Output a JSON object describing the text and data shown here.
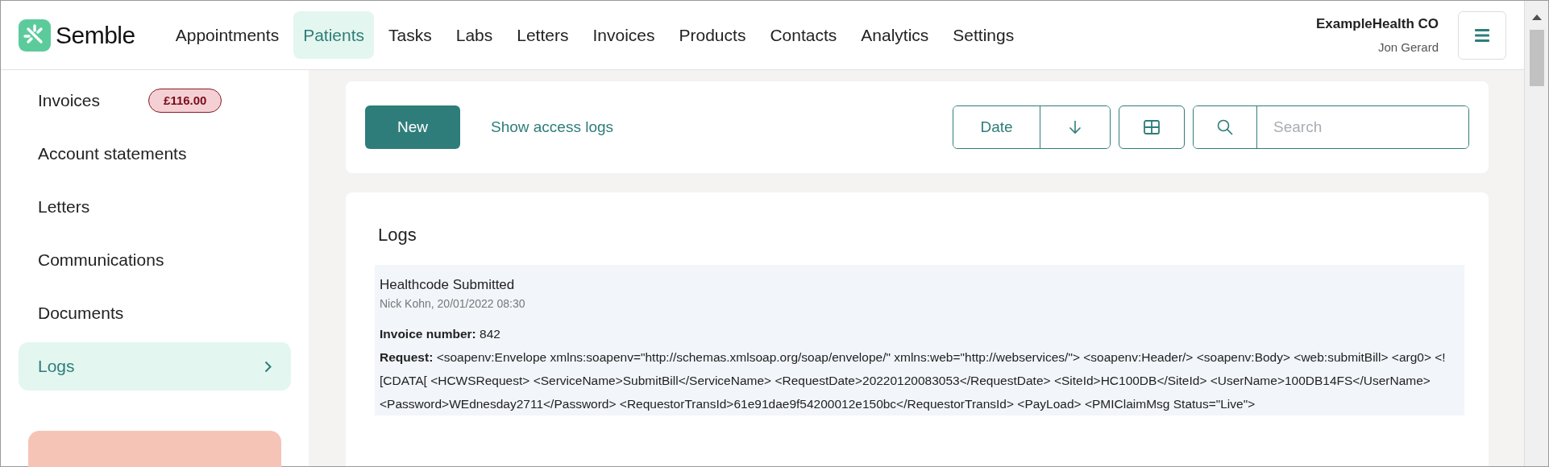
{
  "brand": {
    "name": "Semble"
  },
  "nav": [
    {
      "label": "Appointments",
      "selected": false
    },
    {
      "label": "Patients",
      "selected": true
    },
    {
      "label": "Tasks",
      "selected": false
    },
    {
      "label": "Labs",
      "selected": false
    },
    {
      "label": "Letters",
      "selected": false
    },
    {
      "label": "Invoices",
      "selected": false
    },
    {
      "label": "Products",
      "selected": false
    },
    {
      "label": "Contacts",
      "selected": false
    },
    {
      "label": "Analytics",
      "selected": false
    },
    {
      "label": "Settings",
      "selected": false
    }
  ],
  "account": {
    "organisation": "ExampleHealth CO",
    "user": "Jon Gerard"
  },
  "sidebar": {
    "items": [
      {
        "label": "Invoices",
        "badge": "£116.00",
        "selected": false
      },
      {
        "label": "Account statements",
        "selected": false
      },
      {
        "label": "Letters",
        "selected": false
      },
      {
        "label": "Communications",
        "selected": false
      },
      {
        "label": "Documents",
        "selected": false
      },
      {
        "label": "Logs",
        "selected": true
      }
    ]
  },
  "toolbar": {
    "new_button": "New",
    "link": "Show access logs",
    "sort": "Date",
    "search": {
      "placeholder": "Search"
    }
  },
  "logs": {
    "title": "Logs",
    "entries": [
      {
        "title": "Healthcode Submitted",
        "meta": "Nick Kohn, 20/01/2022 08:30",
        "lines": [
          "**Invoice number:** 842",
          "**Request:** <soapenv:Envelope xmlns:soapenv=\"http://schemas.xmlsoap.org/soap/envelope/\" xmlns:web=\"http://webservices/\"> <soapenv:Header/> <soapenv:Body> <web:submitBill> <arg0> <![CDATA[ <HCWSRequest> <ServiceName>SubmitBill</ServiceName> <RequestDate>20220120083053</RequestDate> <SiteId>HC100DB</SiteId> <UserName>100DB14FS</UserName> <Password>WEdnesday2711</Password> <RequestorTransId>61e91dae9f54200012e150bc</RequestorTransId> <PayLoad> <PMIClaimMsg Status=\"Live\">"
        ]
      }
    ]
  }
}
